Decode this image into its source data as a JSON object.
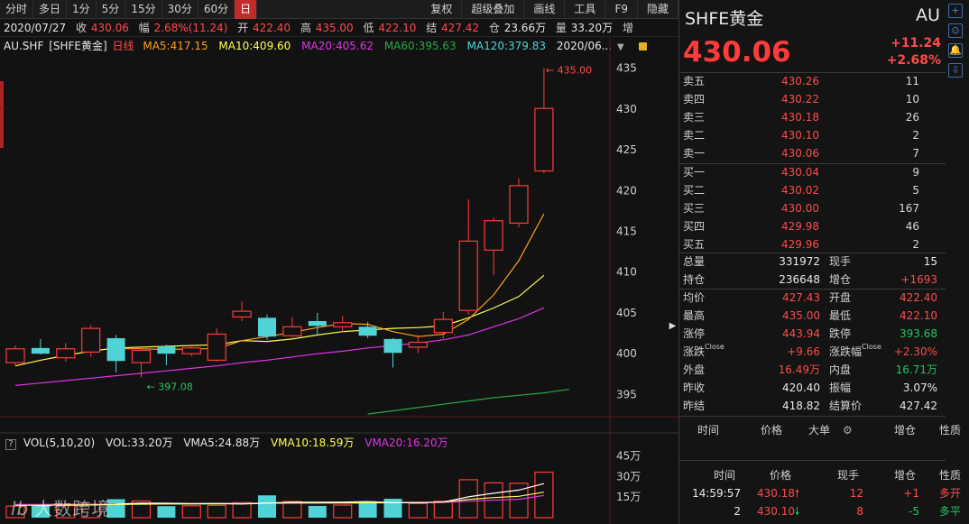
{
  "toolbar": {
    "tabs": [
      "分时",
      "多日",
      "1分",
      "5分",
      "15分",
      "30分",
      "60分",
      "日"
    ],
    "active_tab": "日",
    "right_buttons": [
      "复权",
      "超级叠加",
      "画线",
      "工具",
      "F9",
      "隐藏"
    ]
  },
  "infobar": {
    "date": "2020/07/27",
    "close_label": "收",
    "close": "430.06",
    "range_label": "幅",
    "range": "2.68%(11.24)",
    "open_label": "开",
    "open": "422.40",
    "high_label": "高",
    "high": "435.00",
    "low_label": "低",
    "low": "422.10",
    "settle_label": "结",
    "settle": "427.42",
    "oi_label": "仓",
    "oi": "23.66万",
    "vol_label": "量",
    "vol": "33.20万",
    "extra": "增"
  },
  "ma_legend": {
    "symbol": "AU.SHF",
    "name": "[SHFE黄金]",
    "period": "日线",
    "ma5": "MA5:417.15",
    "ma10": "MA10:409.60",
    "ma20": "MA20:405.62",
    "ma60": "MA60:395.63",
    "ma120": "MA120:379.83",
    "date_short": "2020/06..."
  },
  "vol_legend": {
    "qbox": "?",
    "title": "VOL(5,10,20)",
    "vol": "VOL:33.20万",
    "vma5": "VMA5:24.88万",
    "vma10": "VMA10:18.59万",
    "vma20": "VMA20:16.20万"
  },
  "watermark": {
    "logo": "lb",
    "text": "大数跨境"
  },
  "colors": {
    "up": "#ff3b3b",
    "down": "#4fd3d6",
    "ma5": "#ff9f1a",
    "ma10": "#ffff50",
    "ma20": "#e233e6",
    "ma60": "#28a745",
    "grid": "#2a1010",
    "bg": "#121212"
  },
  "chart_data": {
    "type": "candlestick",
    "y_ticks": [
      435,
      430,
      425,
      420,
      415,
      410,
      405,
      400,
      395
    ],
    "ylim": [
      392.5,
      436.5
    ],
    "high_annotation": "435.00",
    "low_annotation": "397.08",
    "candles": [
      {
        "o": 398.9,
        "h": 401.0,
        "l": 398.5,
        "c": 400.6
      },
      {
        "o": 400.7,
        "h": 401.8,
        "l": 399.9,
        "c": 400.0
      },
      {
        "o": 399.5,
        "h": 401.3,
        "l": 399.0,
        "c": 400.6
      },
      {
        "o": 400.2,
        "h": 403.5,
        "l": 399.6,
        "c": 403.1
      },
      {
        "o": 401.9,
        "h": 402.3,
        "l": 397.7,
        "c": 399.1
      },
      {
        "o": 398.9,
        "h": 400.8,
        "l": 397.1,
        "c": 400.4
      },
      {
        "o": 400.9,
        "h": 401.1,
        "l": 398.6,
        "c": 400.0
      },
      {
        "o": 400.0,
        "h": 401.2,
        "l": 399.7,
        "c": 400.7
      },
      {
        "o": 399.2,
        "h": 403.1,
        "l": 399.0,
        "c": 402.4
      },
      {
        "o": 404.5,
        "h": 406.4,
        "l": 404.0,
        "c": 405.2
      },
      {
        "o": 404.4,
        "h": 404.8,
        "l": 401.7,
        "c": 402.1
      },
      {
        "o": 402.2,
        "h": 404.5,
        "l": 402.0,
        "c": 403.3
      },
      {
        "o": 404.0,
        "h": 405.0,
        "l": 402.2,
        "c": 403.4
      },
      {
        "o": 403.3,
        "h": 404.6,
        "l": 402.7,
        "c": 403.8
      },
      {
        "o": 403.3,
        "h": 403.9,
        "l": 401.9,
        "c": 402.2
      },
      {
        "o": 401.8,
        "h": 401.9,
        "l": 398.3,
        "c": 400.1
      },
      {
        "o": 400.8,
        "h": 402.3,
        "l": 400.1,
        "c": 401.4
      },
      {
        "o": 402.6,
        "h": 405.1,
        "l": 401.9,
        "c": 404.2
      },
      {
        "o": 405.3,
        "h": 418.9,
        "l": 404.8,
        "c": 413.8
      },
      {
        "o": 412.7,
        "h": 416.7,
        "l": 409.6,
        "c": 416.3
      },
      {
        "o": 416.0,
        "h": 421.5,
        "l": 415.5,
        "c": 420.6
      },
      {
        "o": 422.4,
        "h": 435.0,
        "l": 422.1,
        "c": 430.06
      }
    ],
    "ma5": [
      null,
      null,
      null,
      null,
      400.6,
      400.6,
      400.5,
      400.6,
      400.6,
      401.6,
      402.1,
      402.6,
      403.2,
      403.7,
      403.6,
      402.7,
      402.1,
      402.4,
      404.2,
      407.2,
      411.4,
      417.15
    ],
    "ma10": [
      398.5,
      399.2,
      399.8,
      400.3,
      400.7,
      400.8,
      400.9,
      401.0,
      401.1,
      401.6,
      401.5,
      401.8,
      402.3,
      402.7,
      402.9,
      403.1,
      403.2,
      403.4,
      404.4,
      405.6,
      407.0,
      409.6
    ],
    "ma20": [
      396.1,
      396.4,
      396.7,
      397.0,
      397.3,
      397.6,
      397.9,
      398.2,
      398.5,
      398.9,
      399.2,
      399.6,
      400.0,
      400.3,
      400.7,
      401.0,
      401.3,
      401.7,
      402.3,
      403.3,
      404.3,
      405.62
    ],
    "ma60_segment": {
      "from_index": 14,
      "values": [
        392.6,
        393.0,
        393.4,
        393.8,
        394.2,
        394.6,
        394.9,
        395.2,
        395.63
      ]
    },
    "volume": {
      "y_ticks_labels": [
        "45万",
        "30万",
        "15万"
      ],
      "y_ticks_values": [
        45,
        30,
        15
      ],
      "ylim": [
        0,
        50
      ],
      "unit": "万",
      "values": [
        8.5,
        9.0,
        8.8,
        9.5,
        13.5,
        12.2,
        8.4,
        8.7,
        9.0,
        11.0,
        16.3,
        11.8,
        8.6,
        9.2,
        12.0,
        13.8,
        10.3,
        12.0,
        27.7,
        25.4,
        25.1,
        33.2
      ],
      "vma5": [
        null,
        null,
        null,
        null,
        9.9,
        10.6,
        10.5,
        10.3,
        10.4,
        10.1,
        10.7,
        11.3,
        11.3,
        11.4,
        11.7,
        10.9,
        10.9,
        11.4,
        15.2,
        17.8,
        20.1,
        24.88
      ],
      "vma10": [
        9.0,
        9.1,
        9.2,
        9.3,
        9.6,
        9.9,
        10.0,
        10.0,
        10.1,
        10.0,
        10.5,
        10.8,
        10.8,
        10.8,
        10.8,
        11.0,
        11.1,
        11.4,
        13.2,
        14.7,
        15.6,
        18.59
      ],
      "vma20": [
        9.6,
        9.7,
        9.8,
        9.9,
        10.0,
        10.1,
        10.1,
        10.2,
        10.3,
        10.3,
        10.5,
        10.6,
        10.7,
        10.7,
        10.8,
        10.9,
        11.0,
        11.2,
        12.0,
        12.8,
        13.4,
        16.2
      ]
    }
  },
  "panel": {
    "title": "SHFE黄金",
    "code": "AU",
    "last": "430.06",
    "change": "+11.24",
    "change_pct": "+2.68%",
    "side_icons": [
      "+",
      "⊙",
      "🔔",
      "⇩"
    ],
    "asks": [
      {
        "label": "卖五",
        "price": "430.26",
        "vol": "11"
      },
      {
        "label": "卖四",
        "price": "430.22",
        "vol": "10"
      },
      {
        "label": "卖三",
        "price": "430.18",
        "vol": "26"
      },
      {
        "label": "卖二",
        "price": "430.10",
        "vol": "2"
      },
      {
        "label": "卖一",
        "price": "430.06",
        "vol": "7"
      }
    ],
    "bids": [
      {
        "label": "买一",
        "price": "430.04",
        "vol": "9"
      },
      {
        "label": "买二",
        "price": "430.02",
        "vol": "5"
      },
      {
        "label": "买三",
        "price": "430.00",
        "vol": "167"
      },
      {
        "label": "买四",
        "price": "429.98",
        "vol": "46"
      },
      {
        "label": "买五",
        "price": "429.96",
        "vol": "2"
      }
    ],
    "stats_a": [
      {
        "l1": "总量",
        "v1": "331972",
        "c1": "white",
        "l2": "现手",
        "v2": "15",
        "c2": "white"
      },
      {
        "l1": "持仓",
        "v1": "236648",
        "c1": "white",
        "l2": "增仓",
        "v2": "+1693",
        "c2": "red"
      }
    ],
    "stats_b": [
      {
        "l1": "均价",
        "v1": "427.43",
        "c1": "red",
        "l2": "开盘",
        "v2": "422.40",
        "c2": "red"
      },
      {
        "l1": "最高",
        "v1": "435.00",
        "c1": "red",
        "l2": "最低",
        "v2": "422.10",
        "c2": "red"
      },
      {
        "l1": "涨停",
        "v1": "443.94",
        "c1": "red",
        "l2": "跌停",
        "v2": "393.68",
        "c2": "green"
      },
      {
        "l1": "涨跌",
        "l1sup": "Close",
        "v1": "+9.66",
        "c1": "red",
        "l2": "涨跌幅",
        "l2sup": "Close",
        "v2": "+2.30%",
        "c2": "red"
      },
      {
        "l1": "外盘",
        "v1": "16.49万",
        "c1": "red",
        "l2": "内盘",
        "v2": "16.71万",
        "c2": "green"
      },
      {
        "l1": "昨收",
        "v1": "420.40",
        "c1": "white",
        "l2": "振幅",
        "v2": "3.07%",
        "c2": "white"
      },
      {
        "l1": "昨结",
        "v1": "418.82",
        "c1": "white",
        "l2": "结算价",
        "v2": "427.42",
        "c2": "white"
      }
    ],
    "big_header": {
      "time": "时间",
      "price": "价格",
      "big": "大单",
      "oi": "增仓",
      "nature": "性质"
    },
    "ticks_header": {
      "time": "时间",
      "price": "价格",
      "qty": "现手",
      "oi": "增仓",
      "nature": "性质"
    },
    "ticks": [
      {
        "time": "14:59:57",
        "price": "430.18",
        "arrow": "up",
        "qty": "12",
        "oi": "+1",
        "nature": "多开"
      },
      {
        "time": "2",
        "price": "430.10",
        "arrow": "down",
        "qty": "8",
        "oi": "-5",
        "nature": "多平"
      }
    ]
  }
}
